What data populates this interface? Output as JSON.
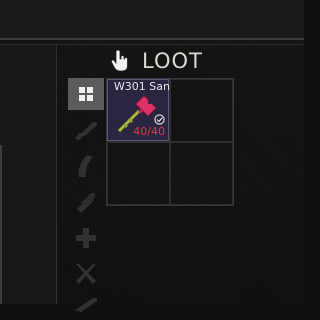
{
  "loot": {
    "title": "LOOT"
  },
  "tabs": [
    {
      "icon": "grid-icon",
      "active": true
    },
    {
      "icon": "rifle-icon",
      "active": false
    },
    {
      "icon": "magazine-icon",
      "active": false
    },
    {
      "icon": "ammo-icon",
      "active": false
    },
    {
      "icon": "medical-icon",
      "active": false
    },
    {
      "icon": "tools-icon",
      "active": false
    },
    {
      "icon": "key-icon",
      "active": false
    }
  ],
  "item": {
    "name": "W301 San",
    "count": "40/40",
    "icon": "key-icon",
    "background": "#2a2540",
    "count_color": "#e23a3a"
  }
}
